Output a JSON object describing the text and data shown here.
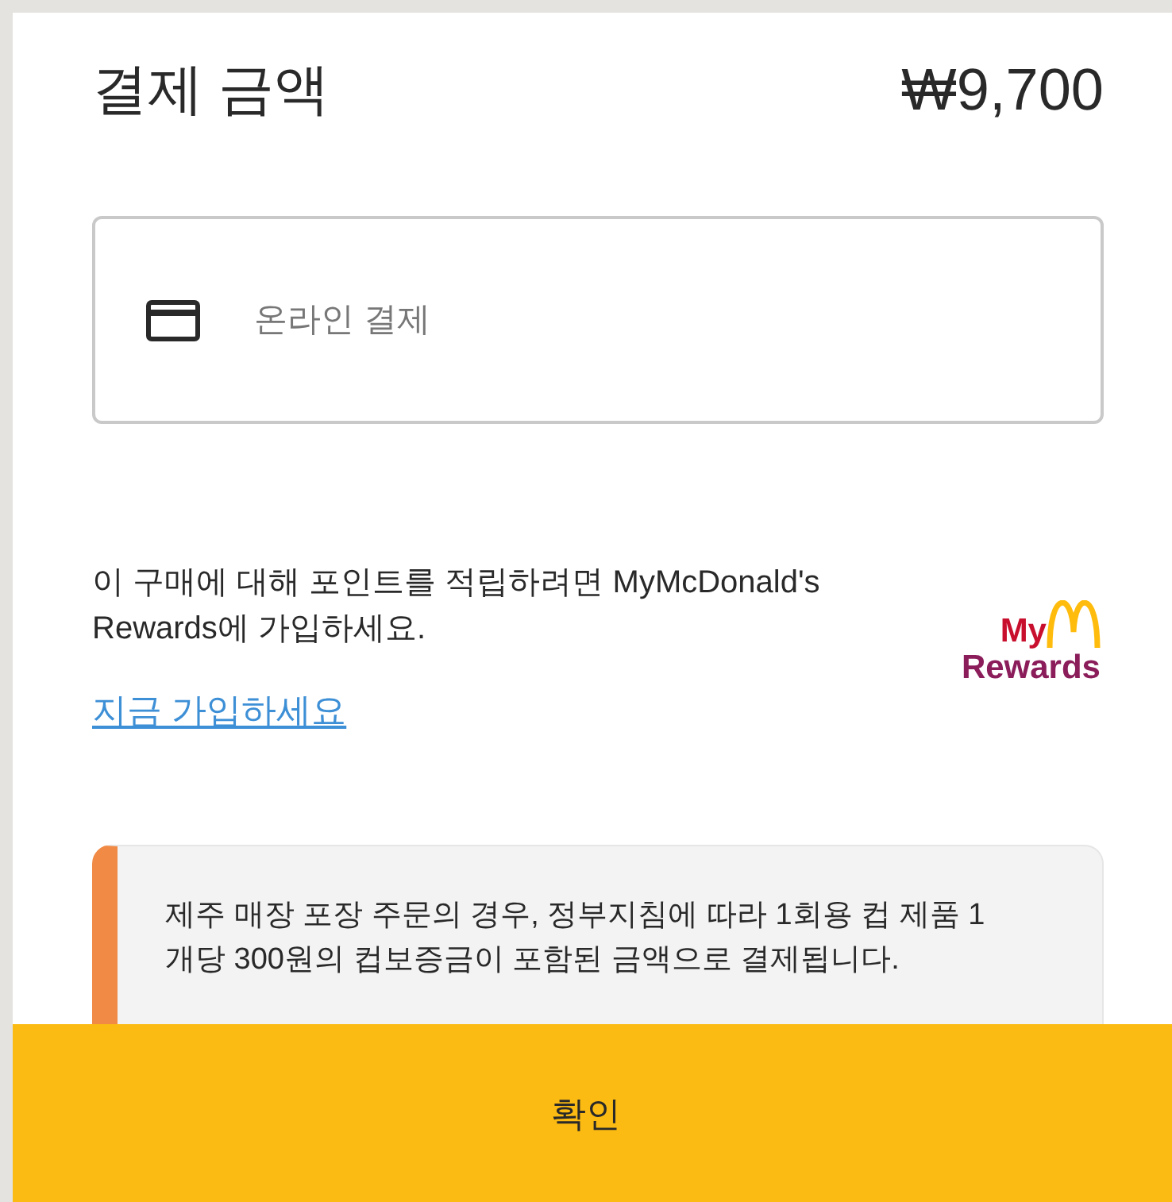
{
  "header": {
    "title": "결제 금액",
    "amount": "₩9,700"
  },
  "payment_method": {
    "label": "온라인 결제"
  },
  "rewards": {
    "message": "이 구매에 대해 포인트를 적립하려면 MyMcDonald's Rewards에 가입하세요.",
    "link": "지금 가입하세요",
    "logo_top": "My",
    "logo_bottom": "Rewards"
  },
  "notice": {
    "text": "제주 매장 포장 주문의 경우, 정부지침에 따라 1회용 컵 제품 1개당 300원의 컵보증금이 포함된 금액으로 결제됩니다.",
    "color": "#f08a44"
  },
  "confirm_button": {
    "label": "확인"
  }
}
